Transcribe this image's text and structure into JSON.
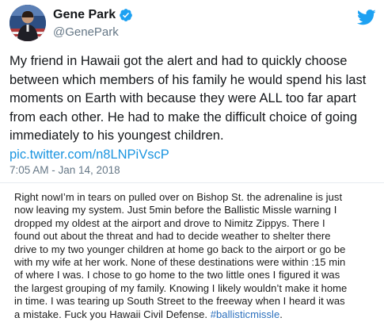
{
  "author": {
    "name": "Gene Park",
    "handle": "@GenePark",
    "verified": true,
    "avatar_icon": "avatar-photo"
  },
  "icons": {
    "verified": "verified-badge-icon",
    "brand": "twitter-bird-icon"
  },
  "colors": {
    "link": "#1b95e0",
    "twitter_brand": "#1da1f2",
    "muted": "#657786"
  },
  "tweet": {
    "text_lines": [
      "My friend in Hawaii got the alert and had to quickly choose",
      "between which members of his family he would spend his last",
      "moments on Earth with because they were ALL too far apart",
      "from each other. He had to make the difficult choice of going",
      "immediately to his youngest children."
    ],
    "link": "pic.twitter.com/n8LNPiVscP",
    "timestamp": "7:05 AM - Jan 14, 2018"
  },
  "attached_image": {
    "lines": [
      "Right nowI’m in tears on pulled over on Bishop St. the adrenaline is just",
      "now leaving my system. Just 5min before the Ballistic Missle warning I",
      "dropped my oldest at the airport and drove to Nimitz Zippys. There I",
      "found out about the threat and had to decide weather to shelter there",
      "drive to my two younger children at home go back to the airport or go be",
      "with my wife at her work. None of these destinations were within :15 min",
      "of where I was. I chose to go home to the two little ones I figured it was",
      "the largest grouping of my family. Knowing I likely wouldn’t make it home",
      "in time. I was tearing up South Street to the freeway when I heard it was"
    ],
    "last_line_prefix": "a mistake. Fuck you Hawaii Civil Defense. ",
    "hashtag": "#ballisticmissle",
    "last_line_suffix": "."
  }
}
